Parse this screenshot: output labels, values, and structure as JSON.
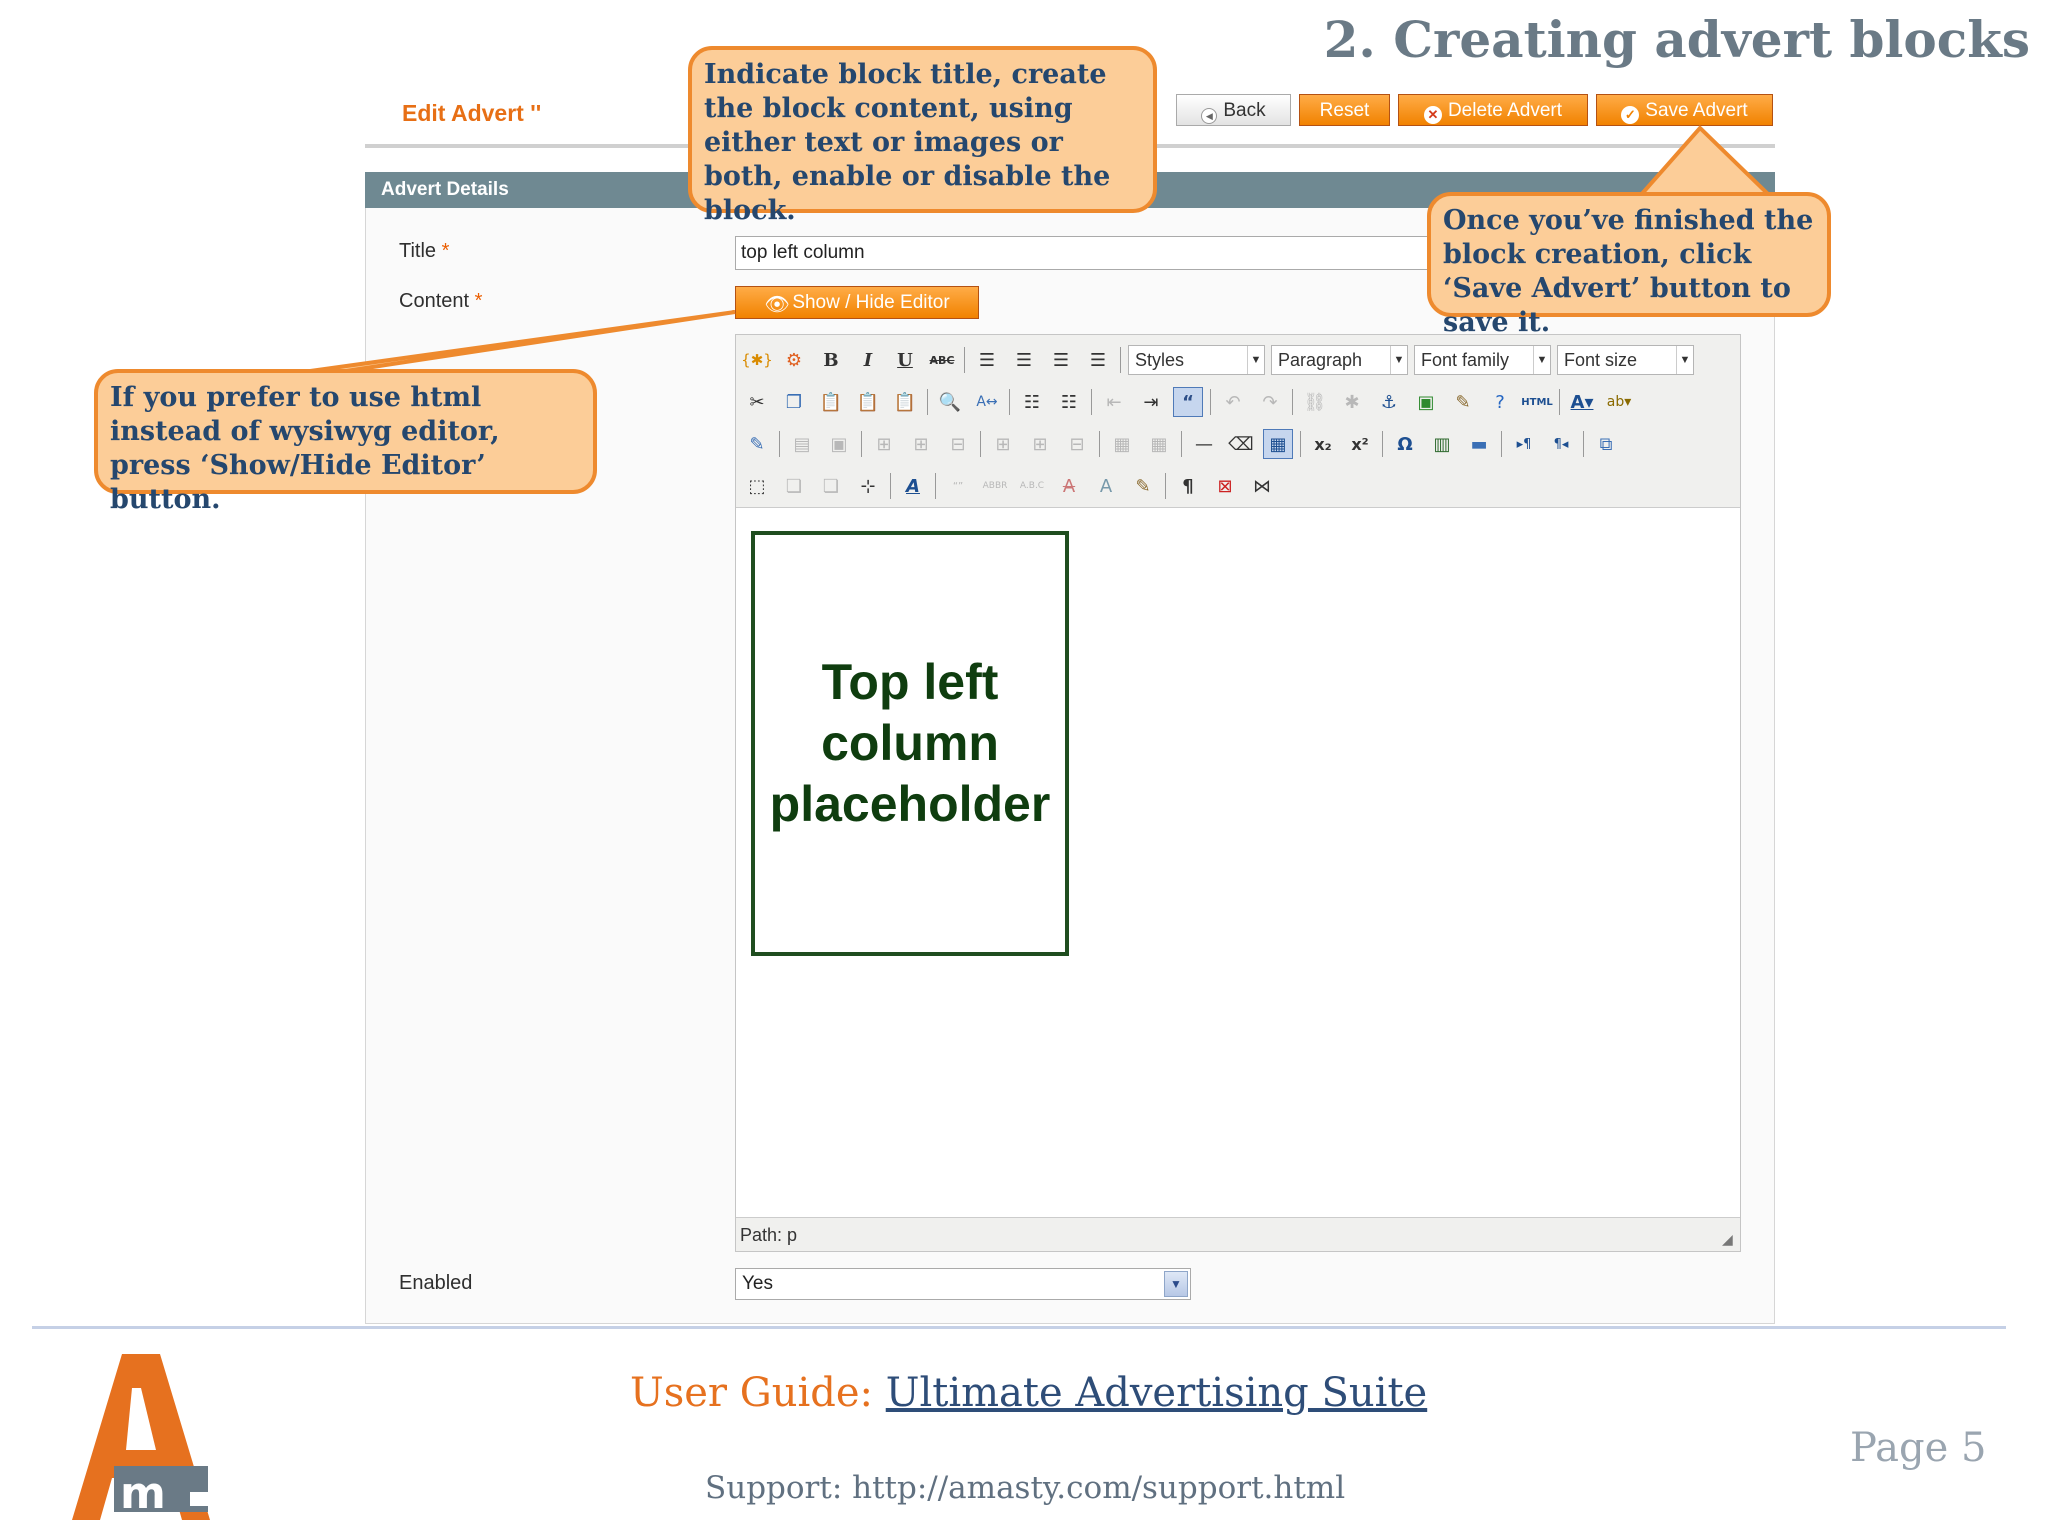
{
  "slide": {
    "title": "2. Creating advert blocks"
  },
  "header": {
    "heading": "Edit Advert ''",
    "buttons": {
      "back": "Back",
      "reset": "Reset",
      "delete": "Delete Advert",
      "save": "Save Advert"
    }
  },
  "form": {
    "section_title": "Advert Details",
    "title_label": "Title",
    "title_value": "top left column",
    "content_label": "Content",
    "required_mark": "*",
    "show_hide_label": "Show / Hide Editor",
    "enabled_label": "Enabled",
    "enabled_value": "Yes"
  },
  "editor": {
    "styles": "Styles",
    "format": "Paragraph",
    "font_family": "Font family",
    "font_size": "Font size",
    "path": "Path: p",
    "placeholder_text": "Top left column placeholder"
  },
  "callouts": {
    "top": "Indicate block title, create the block content, using either text or images or both, enable or disable the block.",
    "right": "Once you’ve finished the block creation, click ‘Save Advert’ button to save it.",
    "left": "If you prefer to use html instead of wysiwyg editor, press ‘Show/Hide Editor’ button."
  },
  "footer": {
    "guide_prefix": "User Guide: ",
    "guide_link": "Ultimate Advertising Suite",
    "support": "Support: http://amasty.com/support.html",
    "page": "Page 5"
  },
  "colors": {
    "accent": "#ee8a2e",
    "callout_bg": "#fccd98",
    "callout_text": "#25476e",
    "panel_head": "#6f8992"
  }
}
